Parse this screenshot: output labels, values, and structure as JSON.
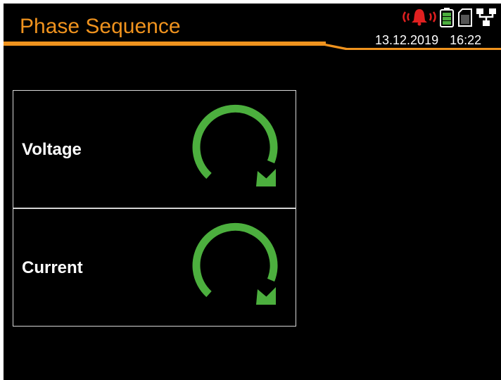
{
  "header": {
    "title": "Phase Sequence",
    "date": "13.12.2019",
    "time": "16:22",
    "status_icons": [
      "alarm-bell-icon",
      "battery-icon",
      "sd-card-icon",
      "network-icon"
    ]
  },
  "panels": [
    {
      "label": "Voltage",
      "rotation": "clockwise",
      "rotation_icon": "clockwise-rotation-icon"
    },
    {
      "label": "Current",
      "rotation": "clockwise",
      "rotation_icon": "clockwise-rotation-icon"
    }
  ],
  "colors": {
    "accent": "#f0931e",
    "alarm": "#e02020",
    "battery": "#4caf3e",
    "rotation_ok": "#4caf3e",
    "background": "#000000"
  }
}
